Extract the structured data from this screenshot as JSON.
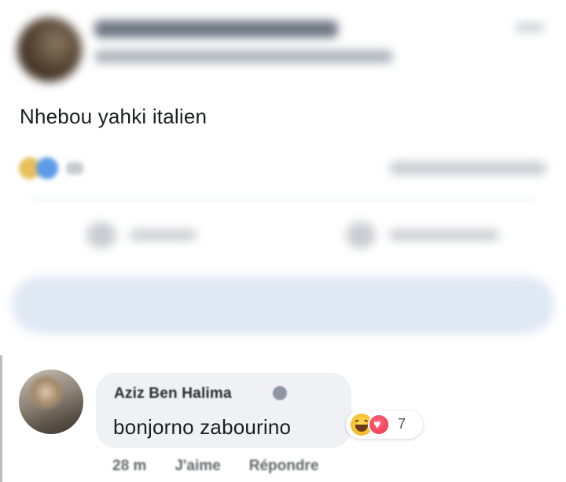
{
  "post": {
    "text": "Nhebou yahki italien"
  },
  "comment": {
    "author": "Aziz Ben Halima",
    "text": "bonjorno zabourino",
    "reaction_count": "7",
    "time": "28 m",
    "like_label": "J'aime",
    "reply_label": "Répondre"
  },
  "icons": {
    "haha": "haha-reaction-icon",
    "love": "love-reaction-icon",
    "verified": "verified-badge-icon"
  },
  "colors": {
    "bubble": "#eff1f4",
    "meta_text": "#65676b",
    "love": "#f33e58",
    "haha": "#f7b928"
  }
}
